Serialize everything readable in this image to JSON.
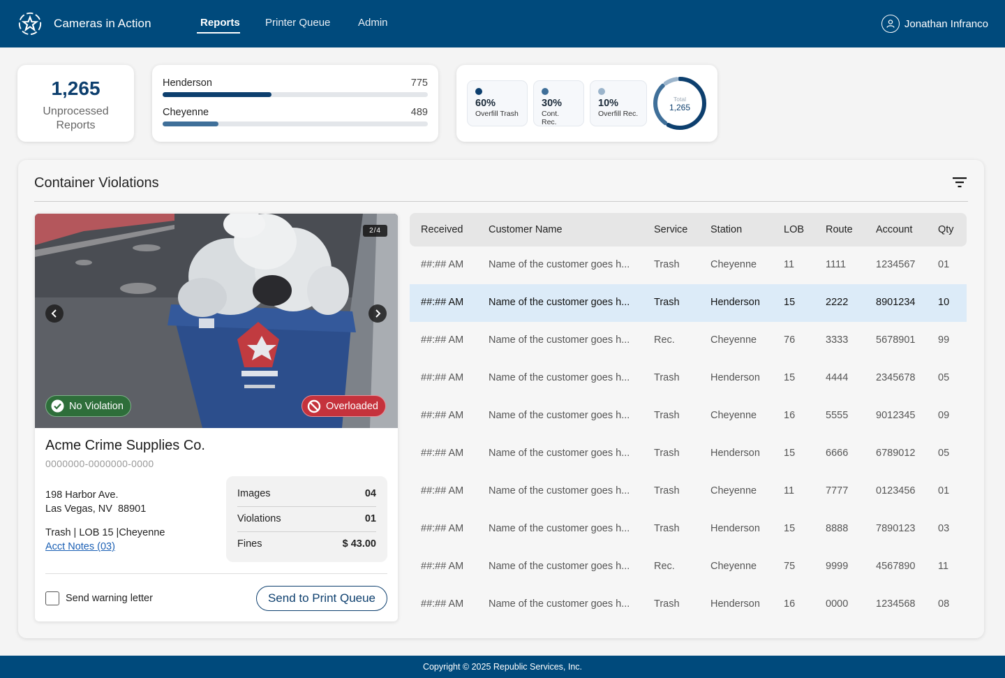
{
  "app": {
    "title": "Cameras in Action"
  },
  "nav": {
    "items": [
      {
        "label": "Reports"
      },
      {
        "label": "Printer Queue"
      },
      {
        "label": "Admin"
      }
    ]
  },
  "user": {
    "name": "Jonathan Infranco"
  },
  "stats": {
    "unprocessed_count": "1,265",
    "unprocessed_label": "Unprocessed Reports"
  },
  "stations": [
    {
      "name": "Henderson",
      "count": "775",
      "fraction": 0.41
    },
    {
      "name": "Cheyenne",
      "count": "489",
      "fraction": 0.21
    }
  ],
  "breakdown": {
    "items": [
      {
        "pct": "60%",
        "label": "Overfill Trash",
        "color": "#0d3f6e"
      },
      {
        "pct": "30%",
        "label": "Cont. Rec.",
        "color": "#3f6f99"
      },
      {
        "pct": "10%",
        "label": "Overfill Rec.",
        "color": "#9bb4cb"
      }
    ],
    "total_label": "Total",
    "total_value": "1,265"
  },
  "section": {
    "title": "Container Violations"
  },
  "detail": {
    "image_counter": "2/4",
    "tag_ok": "No Violation",
    "tag_bad": "Overloaded",
    "customer_name": "Acme Crime Supplies Co.",
    "customer_id": "0000000-0000000-0000",
    "address_line1": "198 Harbor Ave.",
    "address_line2": "Las Vegas, NV  88901",
    "service_line": "Trash | LOB 15 |Cheyenne",
    "notes_link": "Acct Notes (03)",
    "summary": [
      {
        "label": "Images",
        "value": "04"
      },
      {
        "label": "Violations",
        "value": "01"
      },
      {
        "label": "Fines",
        "value": "$ 43.00"
      }
    ],
    "warning_label": "Send warning letter",
    "print_button": "Send to Print Queue"
  },
  "table": {
    "headers": [
      "Received",
      "Customer Name",
      "Service",
      "Station",
      "LOB",
      "Route",
      "Account",
      "Qty"
    ],
    "rows": [
      [
        "##:## AM",
        "Name of the customer goes h...",
        "Trash",
        "Cheyenne",
        "11",
        "1111",
        "1234567",
        "01"
      ],
      [
        "##:## AM",
        "Name of the customer goes h...",
        "Trash",
        "Henderson",
        "15",
        "2222",
        "8901234",
        "10"
      ],
      [
        "##:## AM",
        "Name of the customer goes h...",
        "Rec.",
        "Cheyenne",
        "76",
        "3333",
        "5678901",
        "99"
      ],
      [
        "##:## AM",
        "Name of the customer goes h...",
        "Trash",
        "Henderson",
        "15",
        "4444",
        "2345678",
        "05"
      ],
      [
        "##:## AM",
        "Name of the customer goes h...",
        "Trash",
        "Cheyenne",
        "16",
        "5555",
        "9012345",
        "09"
      ],
      [
        "##:## AM",
        "Name of the customer goes h...",
        "Trash",
        "Henderson",
        "15",
        "6666",
        "6789012",
        "05"
      ],
      [
        "##:## AM",
        "Name of the customer goes h...",
        "Trash",
        "Cheyenne",
        "11",
        "7777",
        "0123456",
        "01"
      ],
      [
        "##:## AM",
        "Name of the customer goes h...",
        "Trash",
        "Henderson",
        "15",
        "8888",
        "7890123",
        "03"
      ],
      [
        "##:## AM",
        "Name of the customer goes h...",
        "Rec.",
        "Cheyenne",
        "75",
        "9999",
        "4567890",
        "11"
      ],
      [
        "##:## AM",
        "Name of the customer goes h...",
        "Trash",
        "Henderson",
        "16",
        "0000",
        "1234568",
        "08"
      ]
    ],
    "selected_row": 1
  },
  "footer": {
    "copyright": "Copyright © 2025 Republic Services, Inc."
  },
  "colors": {
    "brand": "#004a7c",
    "accent": "#0d3f6e",
    "selected_row": "#dcebf8",
    "ok": "#2e6e3a",
    "bad": "#c5323c"
  }
}
